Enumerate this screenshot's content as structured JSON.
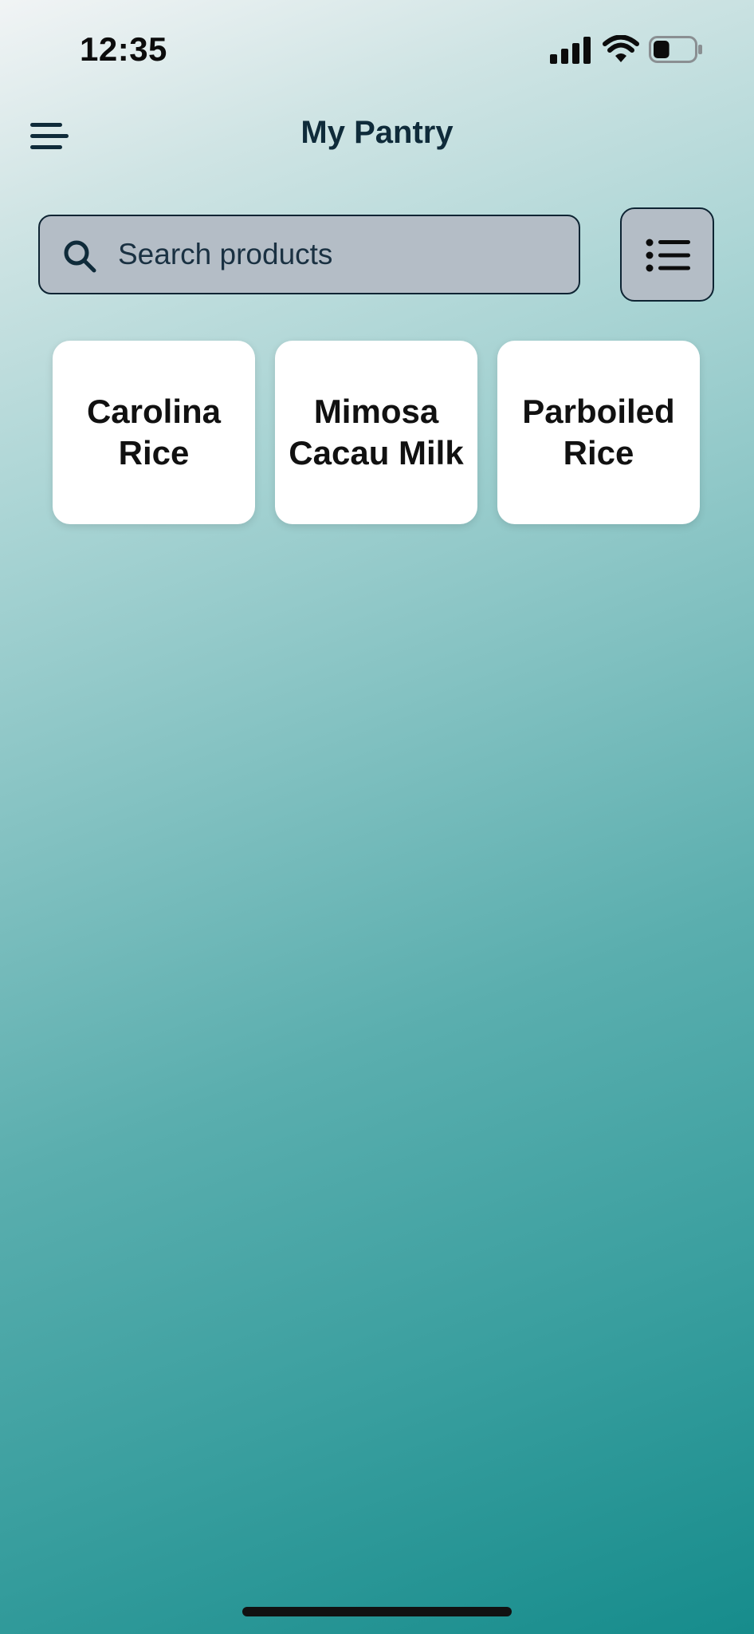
{
  "status_bar": {
    "time": "12:35",
    "icons": [
      "cellular-signal-icon",
      "wifi-icon",
      "battery-icon"
    ],
    "battery_level": 0.4
  },
  "header": {
    "title": "My Pantry",
    "menu_icon": "hamburger-menu-icon"
  },
  "search": {
    "placeholder": "Search products",
    "value": "",
    "icon": "search-icon"
  },
  "view_toggle": {
    "icon": "list-view-icon"
  },
  "products": [
    {
      "name": "Carolina Rice"
    },
    {
      "name": "Mimosa Cacau Milk"
    },
    {
      "name": "Parboiled Rice"
    }
  ],
  "colors": {
    "title": "#0f2b3a",
    "search_bg": "#b4bdc6",
    "card_bg": "#ffffff",
    "gradient_top": "#f1f4f5",
    "gradient_bottom": "#168c8c"
  }
}
